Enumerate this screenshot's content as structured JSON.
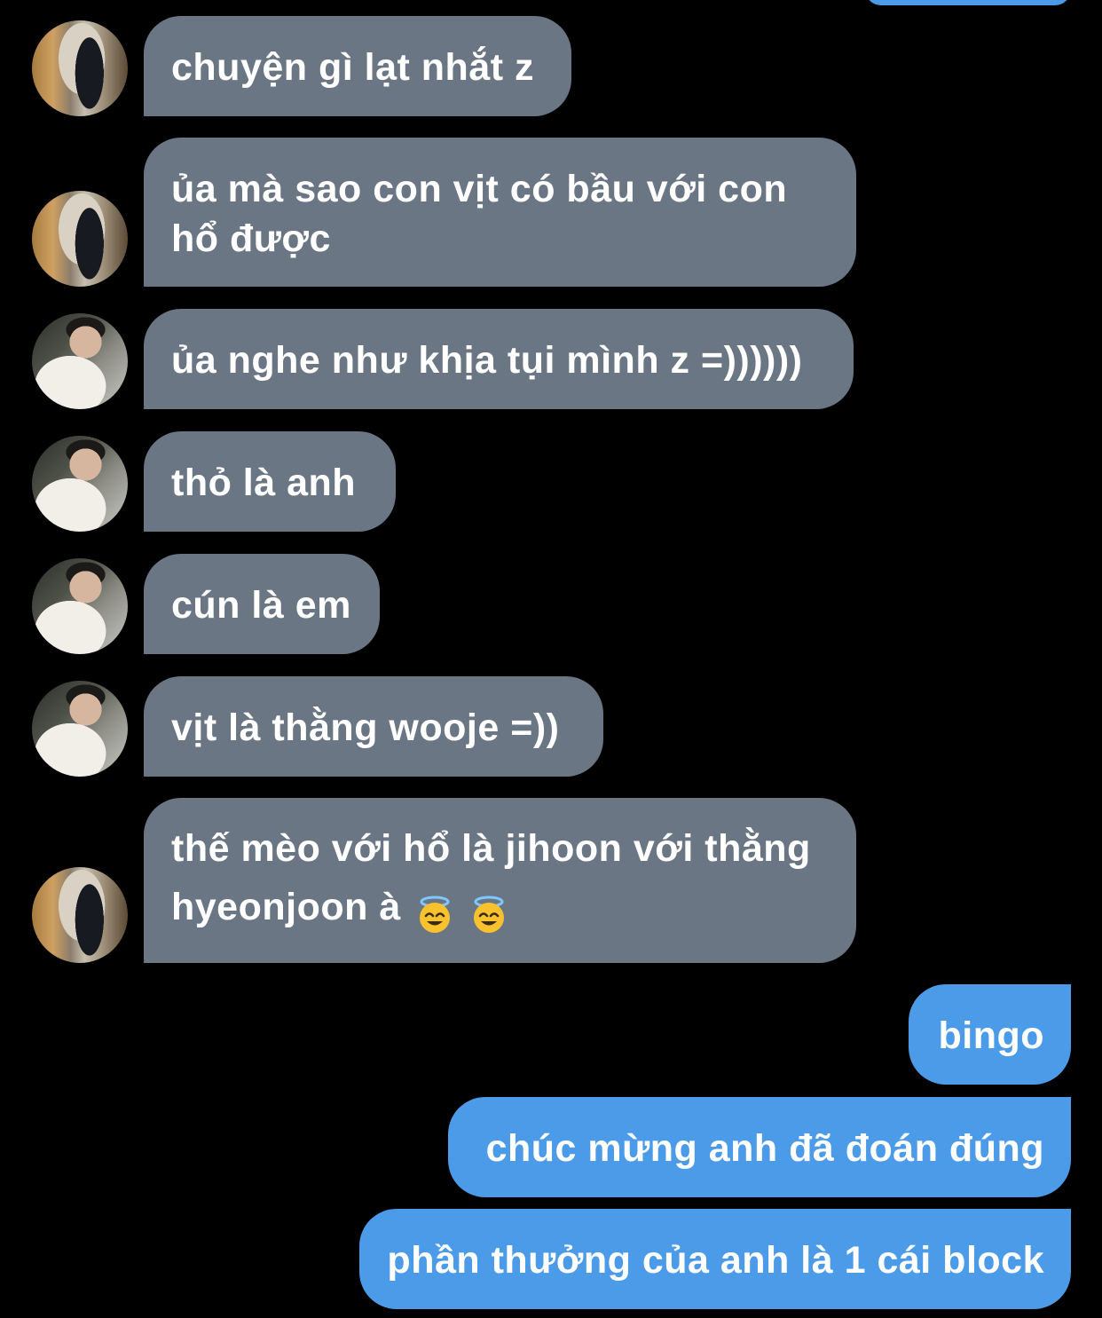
{
  "conversation": {
    "messages": [
      {
        "direction": "incoming",
        "sender_avatar": "avatar-hooded-person",
        "lines": [
          "chuyện gì lạt nhắt z"
        ]
      },
      {
        "direction": "incoming",
        "sender_avatar": "avatar-hooded-person",
        "lines": [
          "ủa mà sao con vịt có bầu với con",
          "hổ được"
        ]
      },
      {
        "direction": "incoming",
        "sender_avatar": "avatar-person-with-dog",
        "lines": [
          "ủa nghe như khịa tụi mình z =))))))"
        ]
      },
      {
        "direction": "incoming",
        "sender_avatar": "avatar-person-with-dog",
        "lines": [
          "thỏ là anh"
        ]
      },
      {
        "direction": "incoming",
        "sender_avatar": "avatar-person-with-dog",
        "lines": [
          "cún là em"
        ]
      },
      {
        "direction": "incoming",
        "sender_avatar": "avatar-person-with-dog",
        "lines": [
          "vịt là thằng wooje =))"
        ]
      },
      {
        "direction": "incoming",
        "sender_avatar": "avatar-hooded-person",
        "lines": [
          "thế mèo với hổ là jihoon với thằng",
          "hyeonjoon à"
        ],
        "trailing_emoji": [
          "smiling-face-with-halo",
          "smiling-face-with-halo"
        ]
      },
      {
        "direction": "outgoing",
        "lines": [
          "bingo"
        ]
      },
      {
        "direction": "outgoing",
        "lines": [
          "chúc mừng anh đã đoán đúng"
        ]
      },
      {
        "direction": "outgoing",
        "lines": [
          "phần thưởng của anh là 1 cái block"
        ]
      }
    ]
  },
  "colors": {
    "background": "#000000",
    "incoming_bubble": "#6B7684",
    "outgoing_bubble": "#4C9BE8",
    "text": "#FFFFFF"
  }
}
